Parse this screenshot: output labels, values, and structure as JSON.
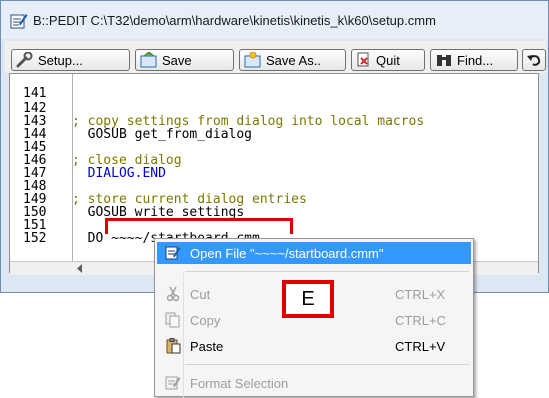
{
  "window": {
    "title": "B::PEDIT C:\\T32\\demo\\arm\\hardware\\kinetis\\kinetis_k\\k60\\setup.cmm"
  },
  "toolbar": {
    "setup_label": "Setup...",
    "save_label": "Save",
    "save_as_label": "Save As..",
    "quit_label": "Quit",
    "find_label": "Find..."
  },
  "editor": {
    "lines": [
      {
        "num": "141",
        "code": ""
      },
      {
        "num": "142",
        "code": "; copy settings from dialog into local macros"
      },
      {
        "num": "143",
        "code": "  GOSUB get_from_dialog"
      },
      {
        "num": "144",
        "code": ""
      },
      {
        "num": "145",
        "code": "; close dialog"
      },
      {
        "num": "146",
        "code": "  DIALOG.END"
      },
      {
        "num": "147",
        "code": ""
      },
      {
        "num": "148",
        "code": "; store current dialog entries"
      },
      {
        "num": "149",
        "code": "  GOSUB write_settings"
      },
      {
        "num": "150",
        "code": ""
      },
      {
        "num": "151",
        "code": "  DO ~~~~/startboard.cmm"
      },
      {
        "num": "152",
        "code": ""
      }
    ]
  },
  "context_menu": {
    "open_file": "Open File \"~~~~/startboard.cmm\"",
    "cut": "Cut",
    "cut_shortcut": "CTRL+X",
    "copy": "Copy",
    "copy_shortcut": "CTRL+C",
    "paste": "Paste",
    "paste_shortcut": "CTRL+V",
    "format_selection": "Format Selection"
  },
  "callout": {
    "label": "E"
  },
  "colors": {
    "highlight_red": "#e00000",
    "menu_selection": "#3399ff",
    "comment": "#7a7a00",
    "keyword": "#0000cc"
  }
}
